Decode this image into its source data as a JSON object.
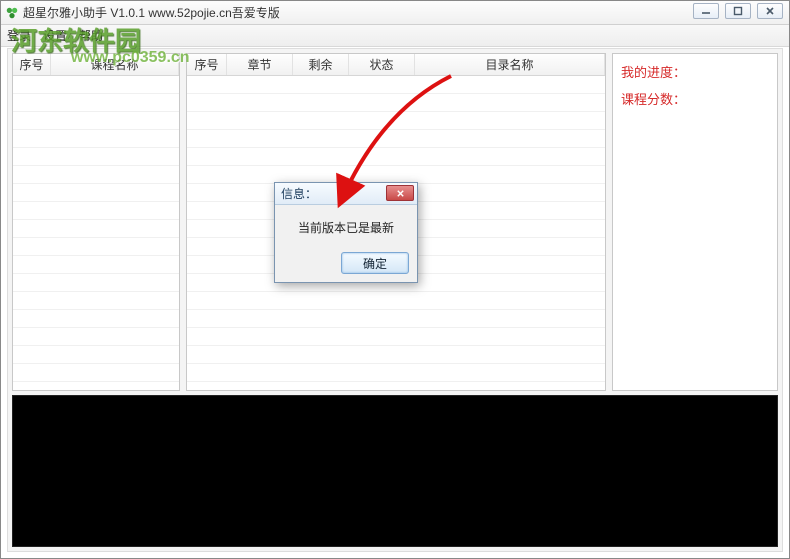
{
  "window": {
    "title": "超星尔雅小助手 V1.0.1  www.52pojie.cn吾爱专版"
  },
  "menu": {
    "login": "登录",
    "settings": "设置",
    "help": "帮助"
  },
  "leftGrid": {
    "cols": {
      "idx": "序号",
      "name": "课程名称"
    }
  },
  "midGrid": {
    "cols": {
      "idx": "序号",
      "chapter": "章节",
      "remain": "剩余",
      "status": "状态",
      "dirname": "目录名称"
    }
  },
  "rightInfo": {
    "progress": "我的进度：",
    "score": "课程分数："
  },
  "modal": {
    "title": "信息：",
    "message": "当前版本已是最新",
    "ok": "确定"
  },
  "watermarks": {
    "w1": "河东软件园",
    "w2": "www.pc0359.cn"
  }
}
